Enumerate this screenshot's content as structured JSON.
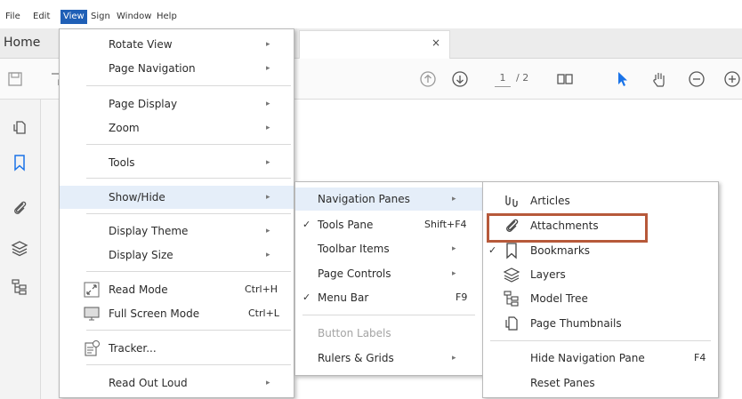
{
  "menubar": {
    "items": [
      "File",
      "Edit",
      "View",
      "Sign",
      "Window",
      "Help"
    ],
    "active": "View"
  },
  "tabs": {
    "home": "Home",
    "close": "×"
  },
  "toolbar": {
    "page_current": "1",
    "page_total": "/ 2"
  },
  "view_menu": {
    "items": [
      {
        "label": "Rotate View",
        "arrow": "▸"
      },
      {
        "label": "Page Navigation",
        "arrow": "▸"
      },
      {
        "label": "Page Display",
        "arrow": "▸"
      },
      {
        "label": "Zoom",
        "arrow": "▸"
      },
      {
        "label": "Tools",
        "arrow": "▸"
      },
      {
        "label": "Show/Hide",
        "arrow": "▸"
      },
      {
        "label": "Display Theme",
        "arrow": "▸"
      },
      {
        "label": "Display Size",
        "arrow": "▸"
      },
      {
        "label": "Read Mode",
        "shortcut": "Ctrl+H"
      },
      {
        "label": "Full Screen Mode",
        "shortcut": "Ctrl+L"
      },
      {
        "label": "Tracker..."
      },
      {
        "label": "Read Out Loud",
        "arrow": "▸"
      }
    ]
  },
  "showhide_menu": {
    "items": [
      {
        "label": "Navigation Panes",
        "arrow": "▸"
      },
      {
        "label": "Tools Pane",
        "shortcut": "Shift+F4",
        "check": "✓"
      },
      {
        "label": "Toolbar Items",
        "arrow": "▸"
      },
      {
        "label": "Page Controls",
        "arrow": "▸"
      },
      {
        "label": "Menu Bar",
        "shortcut": "F9",
        "check": "✓"
      },
      {
        "label": "Button Labels"
      },
      {
        "label": "Rulers & Grids",
        "arrow": "▸"
      }
    ]
  },
  "navpanes_menu": {
    "items": [
      {
        "label": "Articles",
        "icon": "articles-icon"
      },
      {
        "label": "Attachments",
        "icon": "paperclip-icon"
      },
      {
        "label": "Bookmarks",
        "icon": "bookmark-icon",
        "check": "✓"
      },
      {
        "label": "Layers",
        "icon": "layers-icon"
      },
      {
        "label": "Model Tree",
        "icon": "model-tree-icon"
      },
      {
        "label": "Page Thumbnails",
        "icon": "page-thumbnails-icon"
      },
      {
        "label": "Hide Navigation Pane",
        "shortcut": "F4"
      },
      {
        "label": "Reset Panes"
      }
    ]
  },
  "colors": {
    "active_menu": "#1f5fb6",
    "highlight_row": "#e5eef9",
    "annotation_box": "#b7593a",
    "cursor_blue": "#1a73e8"
  }
}
